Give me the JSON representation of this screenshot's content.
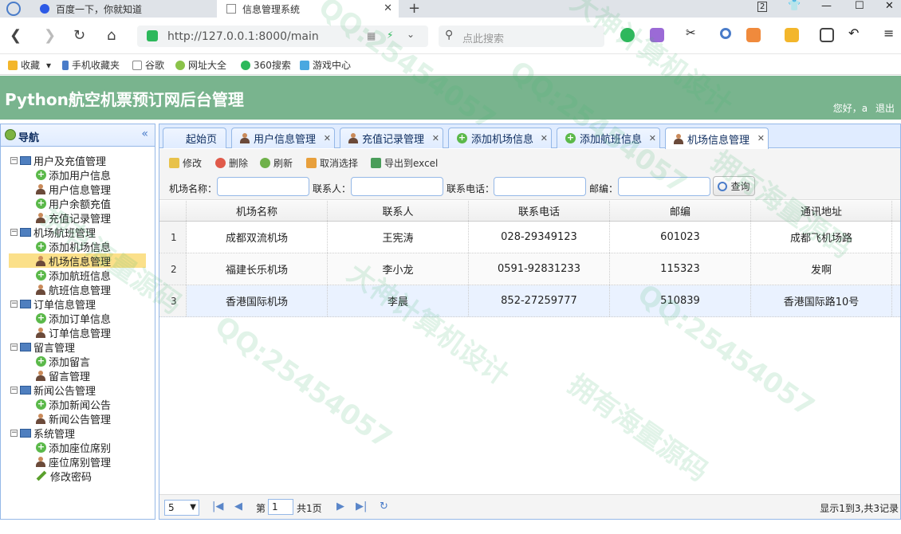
{
  "browser": {
    "tabs": [
      {
        "label": "百度一下，你就知道",
        "active": false
      },
      {
        "label": "信息管理系统",
        "active": true
      }
    ],
    "tab_count_badge": "2",
    "url": "http://127.0.0.1:8000/main",
    "search_placeholder": "点此搜索",
    "bookmarks": [
      "收藏",
      "手机收藏夹",
      "谷歌",
      "网址大全",
      "360搜索",
      "游戏中心"
    ]
  },
  "app": {
    "title": "Python航空机票预订网后台管理",
    "user_greeting": "您好，a",
    "logout": "退出"
  },
  "sidebar": {
    "title": "导航",
    "groups": [
      {
        "label": "用户及充值管理",
        "items": [
          "添加用户信息",
          "用户信息管理",
          "用户余额充值",
          "充值记录管理"
        ]
      },
      {
        "label": "机场航班管理",
        "items": [
          "添加机场信息",
          "机场信息管理",
          "添加航班信息",
          "航班信息管理"
        ]
      },
      {
        "label": "订单信息管理",
        "items": [
          "添加订单信息",
          "订单信息管理"
        ]
      },
      {
        "label": "留言管理",
        "items": [
          "添加留言",
          "留言管理"
        ]
      },
      {
        "label": "新闻公告管理",
        "items": [
          "添加新闻公告",
          "新闻公告管理"
        ]
      },
      {
        "label": "系统管理",
        "items": [
          "添加座位席别",
          "座位席别管理",
          "修改密码"
        ]
      }
    ],
    "selected": "机场信息管理"
  },
  "tabs": [
    {
      "label": "起始页",
      "closable": false,
      "icon": "none"
    },
    {
      "label": "用户信息管理",
      "closable": true,
      "icon": "person-icon"
    },
    {
      "label": "充值记录管理",
      "closable": true,
      "icon": "person-icon"
    },
    {
      "label": "添加机场信息",
      "closable": true,
      "icon": "plus-icon"
    },
    {
      "label": "添加航班信息",
      "closable": true,
      "icon": "plus-icon"
    },
    {
      "label": "机场信息管理",
      "closable": true,
      "icon": "person-icon",
      "active": true
    }
  ],
  "toolbar": {
    "edit": "修改",
    "delete": "删除",
    "refresh": "刷新",
    "cancel_select": "取消选择",
    "export": "导出到excel"
  },
  "search": {
    "airport_name_label": "机场名称：",
    "contact_label": "联系人：",
    "phone_label": "联系电话：",
    "postcode_label": "邮编：",
    "query_button": "查询"
  },
  "table": {
    "columns": [
      "机场名称",
      "联系人",
      "联系电话",
      "邮编",
      "通讯地址"
    ],
    "rows": [
      {
        "num": "1",
        "name": "成都双流机场",
        "contact": "王宪涛",
        "phone": "028-29349123",
        "postcode": "601023",
        "address": "成都飞机场路"
      },
      {
        "num": "2",
        "name": "福建长乐机场",
        "contact": "李小龙",
        "phone": "0591-92831233",
        "postcode": "115323",
        "address": "发啊"
      },
      {
        "num": "3",
        "name": "香港国际机场",
        "contact": "李晨",
        "phone": "852-27259777",
        "postcode": "510839",
        "address": "香港国际路10号"
      }
    ]
  },
  "pager": {
    "page_size": "5",
    "page_prefix": "第",
    "page_value": "1",
    "total_pages": "共1页",
    "summary": "显示1到3,共3记录"
  },
  "watermarks": [
    "QQ:25454057",
    "大神计算机设计",
    "拥有海量源码"
  ],
  "colors": {
    "header_green": "#79b48e",
    "panel_border": "#95b8e7",
    "tab_bg": "#e0ecff",
    "selected_row": "#eaf2ff",
    "selected_tree": "#fbe08a"
  }
}
